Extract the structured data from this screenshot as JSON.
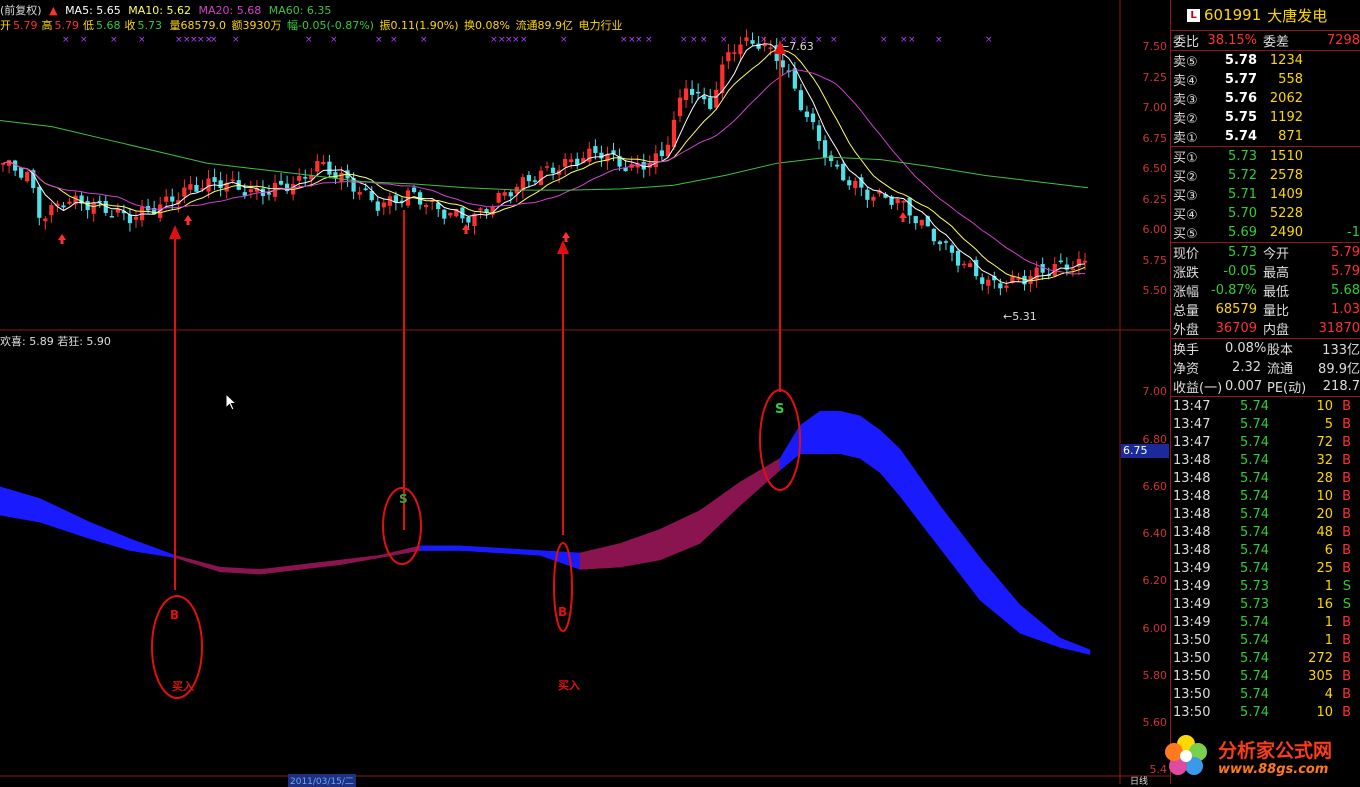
{
  "header": {
    "title": "(前复权)",
    "ma5": "MA5: 5.65",
    "ma10": "MA10: 5.62",
    "ma20": "MA20: 5.68",
    "ma60": "MA60: 6.35",
    "open_label": "开",
    "open_value": "5.79",
    "high_label": "高",
    "high_value": "5.79",
    "low_label": "低",
    "low_value": "5.68",
    "close_label": "收",
    "close_value": "5.73",
    "volume": "量68579.0",
    "amount": "额3930万",
    "change": "幅-0.05(-0.87%)",
    "amplitude": "振0.11(1.90%)",
    "turnover": "换0.08%",
    "float_cap": "流通89.9亿",
    "industry": "电力行业"
  },
  "indicator": {
    "label1": "欢喜: 5.89",
    "label2": "若狂: 5.90"
  },
  "price_axis": [
    "7.50",
    "7.25",
    "7.00",
    "6.75",
    "6.50",
    "6.25",
    "6.00",
    "5.75",
    "5.50"
  ],
  "ind_axis": [
    "7.00",
    "6.80",
    "6.60",
    "6.40",
    "6.20",
    "6.00",
    "5.80",
    "5.60",
    "5.4"
  ],
  "ind_marker": "6.75",
  "annotations": {
    "high_mark": "7.63",
    "low_mark": "5.31",
    "buy1": "B",
    "buy1_text": "买入",
    "sell1": "S",
    "buy2": "B",
    "buy2_text": "买入",
    "sell2": "S"
  },
  "bottom": {
    "date": "2011/03/15/二",
    "unit": "日线"
  },
  "quote": {
    "code": "601991",
    "name": "大唐发电",
    "badge": "L",
    "weibi_label": "委比",
    "weibi_value": "38.15%",
    "weicha_label": "委差",
    "weicha_value": "7298",
    "sells": [
      {
        "label": "卖⑤",
        "price": "5.78",
        "vol": "1234"
      },
      {
        "label": "卖④",
        "price": "5.77",
        "vol": "558"
      },
      {
        "label": "卖③",
        "price": "5.76",
        "vol": "2062"
      },
      {
        "label": "卖②",
        "price": "5.75",
        "vol": "1192"
      },
      {
        "label": "卖①",
        "price": "5.74",
        "vol": "871"
      }
    ],
    "buys": [
      {
        "label": "买①",
        "price": "5.73",
        "vol": "1510"
      },
      {
        "label": "买②",
        "price": "5.72",
        "vol": "2578"
      },
      {
        "label": "买③",
        "price": "5.71",
        "vol": "1409"
      },
      {
        "label": "买④",
        "price": "5.70",
        "vol": "5228"
      },
      {
        "label": "买⑤",
        "price": "5.69",
        "vol": "2490",
        "extra": "-1"
      }
    ],
    "stats": [
      {
        "l1": "现价",
        "v1": "5.73",
        "l2": "今开",
        "v2": "5.79"
      },
      {
        "l1": "涨跌",
        "v1": "-0.05",
        "l2": "最高",
        "v2": "5.79"
      },
      {
        "l1": "涨幅",
        "v1": "-0.87%",
        "l2": "最低",
        "v2": "5.68"
      },
      {
        "l1": "总量",
        "v1": "68579",
        "l2": "量比",
        "v2": "1.03"
      },
      {
        "l1": "外盘",
        "v1": "36709",
        "l2": "内盘",
        "v2": "31870"
      }
    ],
    "fund": [
      {
        "l1": "换手",
        "v1": "0.08%",
        "l2": "股本",
        "v2": "133亿"
      },
      {
        "l1": "净资",
        "v1": "2.32",
        "l2": "流通",
        "v2": "89.9亿"
      },
      {
        "l1": "收益(一)",
        "v1": "0.007",
        "l2": "PE(动)",
        "v2": "218.7"
      }
    ],
    "ticks": [
      {
        "t": "13:47",
        "p": "5.74",
        "v": "10",
        "f": "B"
      },
      {
        "t": "13:47",
        "p": "5.74",
        "v": "5",
        "f": "B"
      },
      {
        "t": "13:47",
        "p": "5.74",
        "v": "72",
        "f": "B"
      },
      {
        "t": "13:48",
        "p": "5.74",
        "v": "32",
        "f": "B"
      },
      {
        "t": "13:48",
        "p": "5.74",
        "v": "28",
        "f": "B"
      },
      {
        "t": "13:48",
        "p": "5.74",
        "v": "10",
        "f": "B"
      },
      {
        "t": "13:48",
        "p": "5.74",
        "v": "20",
        "f": "B"
      },
      {
        "t": "13:48",
        "p": "5.74",
        "v": "48",
        "f": "B"
      },
      {
        "t": "13:48",
        "p": "5.74",
        "v": "6",
        "f": "B"
      },
      {
        "t": "13:49",
        "p": "5.74",
        "v": "25",
        "f": "B"
      },
      {
        "t": "13:49",
        "p": "5.73",
        "v": "1",
        "f": "S"
      },
      {
        "t": "13:49",
        "p": "5.73",
        "v": "16",
        "f": "S"
      },
      {
        "t": "13:49",
        "p": "5.74",
        "v": "1",
        "f": "B"
      },
      {
        "t": "13:50",
        "p": "5.74",
        "v": "1",
        "f": "B"
      },
      {
        "t": "13:50",
        "p": "5.74",
        "v": "272",
        "f": "B"
      },
      {
        "t": "13:50",
        "p": "5.74",
        "v": "305",
        "f": "B"
      },
      {
        "t": "13:50",
        "p": "5.74",
        "v": "4",
        "f": "B"
      },
      {
        "t": "13:50",
        "p": "5.74",
        "v": "10",
        "f": "B"
      }
    ]
  },
  "logo": {
    "text": "分析家公式网",
    "url": "www.88gs.com"
  },
  "colors": {
    "up": "#ff3030",
    "down": "#4fe0e8",
    "ma5": "#ffffff",
    "ma10": "#ffff60",
    "ma20": "#d040d0",
    "ma60": "#40c040",
    "band_blue": "#1a1aff",
    "band_purple": "#8a1450"
  }
}
